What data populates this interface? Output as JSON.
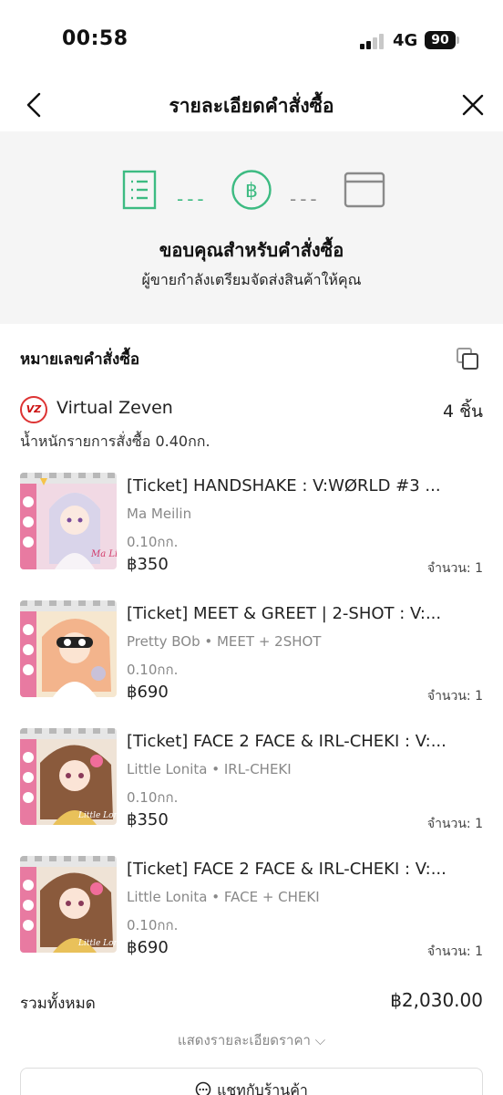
{
  "status_bar": {
    "time": "00:58",
    "network": "4G",
    "battery": "90"
  },
  "nav": {
    "title": "รายละเอียดคำสั่งซื้อ"
  },
  "progress": {
    "title": "ขอบคุณสำหรับคำสั่งซื้อ",
    "subtitle": "ผู้ขายกำลังเตรียมจัดส่งสินค้าให้คุณ",
    "dash": "---",
    "colors": {
      "done": "#3dbb82",
      "pending": "#8a8a8a"
    }
  },
  "order": {
    "header": "หมายเลขคำสั่งซื้อ",
    "shop_logo": "VZ",
    "shop_name": "Virtual Zeven",
    "count": "4 ชิ้น",
    "weight": "น้ำหนักรายการสั่งซื้อ 0.40กก.",
    "items": [
      {
        "title": "[Ticket] HANDSHAKE : V:WØRLD #3 ...",
        "variant": "Ma Meilin",
        "weight": "0.10กก.",
        "price": "฿350",
        "qty": "จำนวน: 1",
        "signature": "Ma Lin"
      },
      {
        "title": "[Ticket] MEET & GREET | 2-SHOT : V:...",
        "variant": "Pretty BOb • MEET + 2SHOT",
        "weight": "0.10กก.",
        "price": "฿690",
        "qty": "จำนวน: 1"
      },
      {
        "title": "[Ticket] FACE 2 FACE & IRL-CHEKI : V:...",
        "variant": "Little Lonita • IRL-CHEKI",
        "weight": "0.10กก.",
        "price": "฿350",
        "qty": "จำนวน: 1"
      },
      {
        "title": "[Ticket] FACE 2 FACE & IRL-CHEKI : V:...",
        "variant": "Little Lonita • FACE + CHEKI",
        "weight": "0.10กก.",
        "price": "฿690",
        "qty": "จำนวน: 1"
      }
    ],
    "total_label": "รวมทั้งหมด",
    "total_value": "฿2,030.00",
    "price_detail": "แสดงรายละเอียดราคา ⌵",
    "chat_button": "แชทกับร้านค้า"
  }
}
